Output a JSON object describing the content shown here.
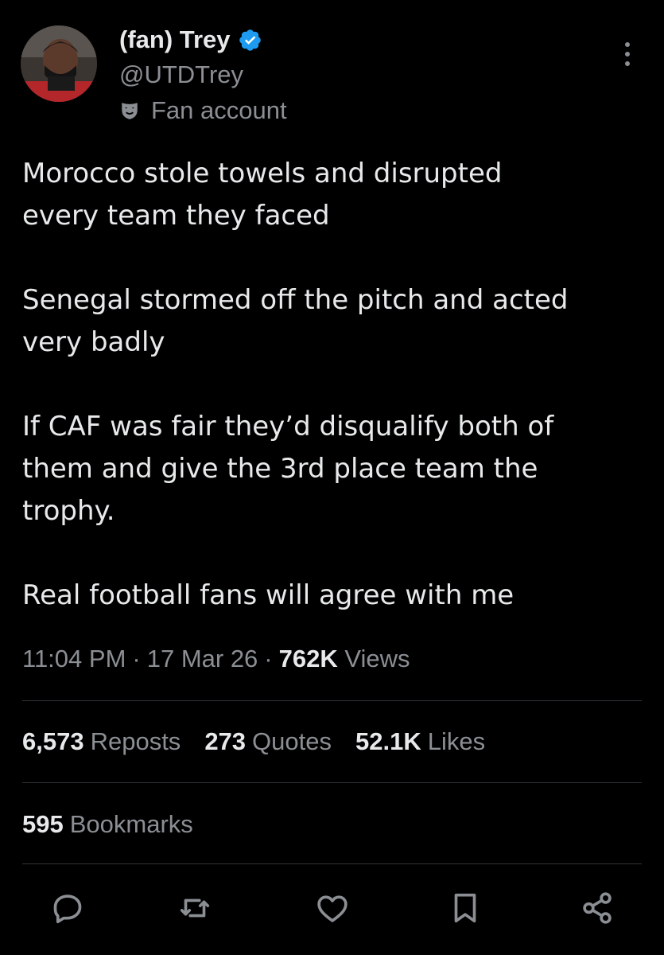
{
  "author": {
    "display_name": "(fan) Trey",
    "handle": "@UTDTrey",
    "label": "Fan account",
    "verified": true,
    "avatar_icon": "avatar-photo"
  },
  "tweet": {
    "paragraphs": [
      "Morocco stole towels and disrupted\nevery team they faced",
      "Senegal stormed off the pitch and acted\nvery badly",
      "If CAF was fair they’d disqualify both of\nthem and give the 3rd place team the\ntrophy.",
      "Real football fans will agree with me"
    ]
  },
  "meta": {
    "time": "11:04 PM",
    "separator": "·",
    "date": "17 Mar 26",
    "views_count": "762K",
    "views_label": "Views"
  },
  "stats": {
    "reposts_count": "6,573",
    "reposts_label": "Reposts",
    "quotes_count": "273",
    "quotes_label": "Quotes",
    "likes_count": "52.1K",
    "likes_label": "Likes",
    "bookmarks_count": "595",
    "bookmarks_label": "Bookmarks"
  },
  "actions": [
    "reply-icon",
    "repost-icon",
    "like-icon",
    "bookmark-icon",
    "share-icon"
  ],
  "colors": {
    "background": "#000000",
    "text": "#e7e9ea",
    "secondary_text": "#8b8f94",
    "verified_blue": "#1d9bf0",
    "divider": "#2f3336"
  }
}
